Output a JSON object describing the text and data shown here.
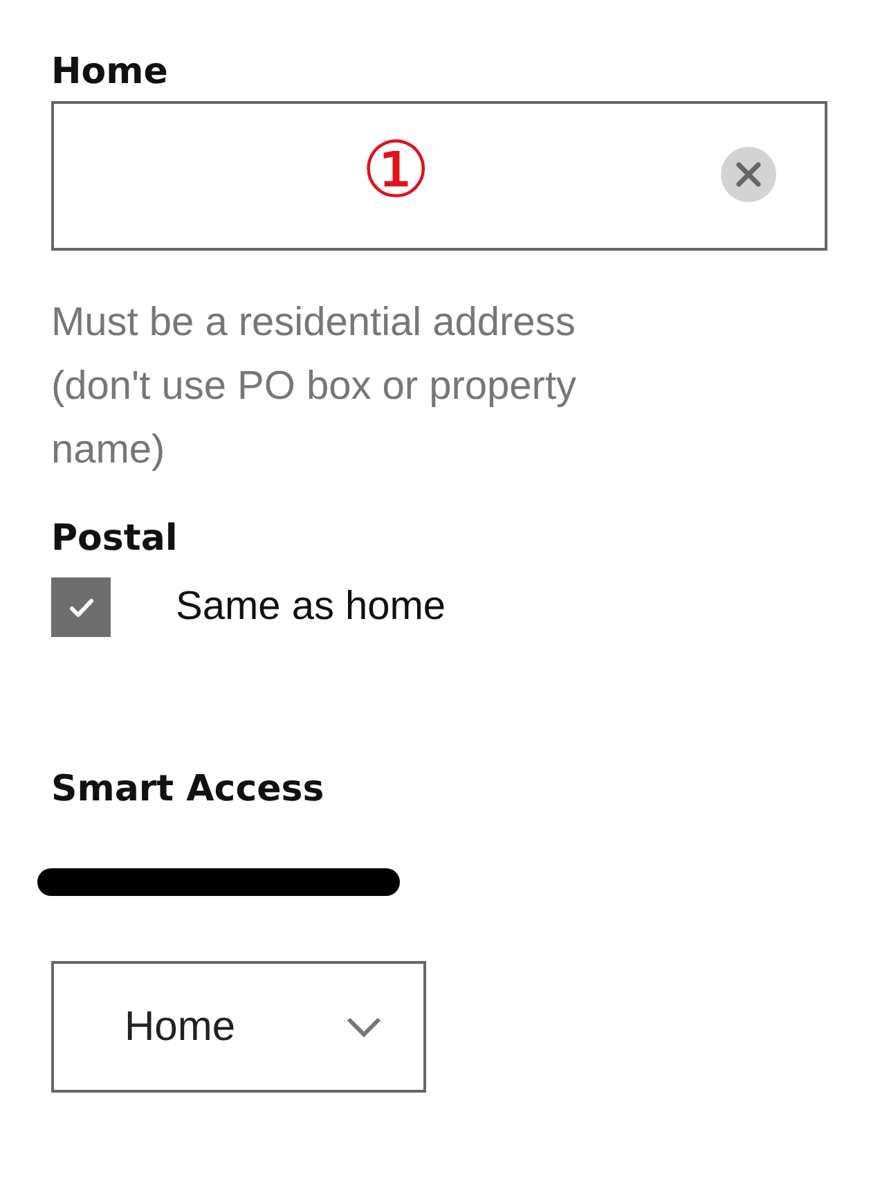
{
  "home": {
    "label": "Home",
    "annotation": "①",
    "hint": "Must be a residential address (don't use PO box or property name)"
  },
  "postal": {
    "label": "Postal",
    "checkbox": {
      "label": "Same as home",
      "checked": true
    }
  },
  "smart_access": {
    "label": "Smart Access",
    "dropdown": {
      "value": "Home"
    }
  }
}
